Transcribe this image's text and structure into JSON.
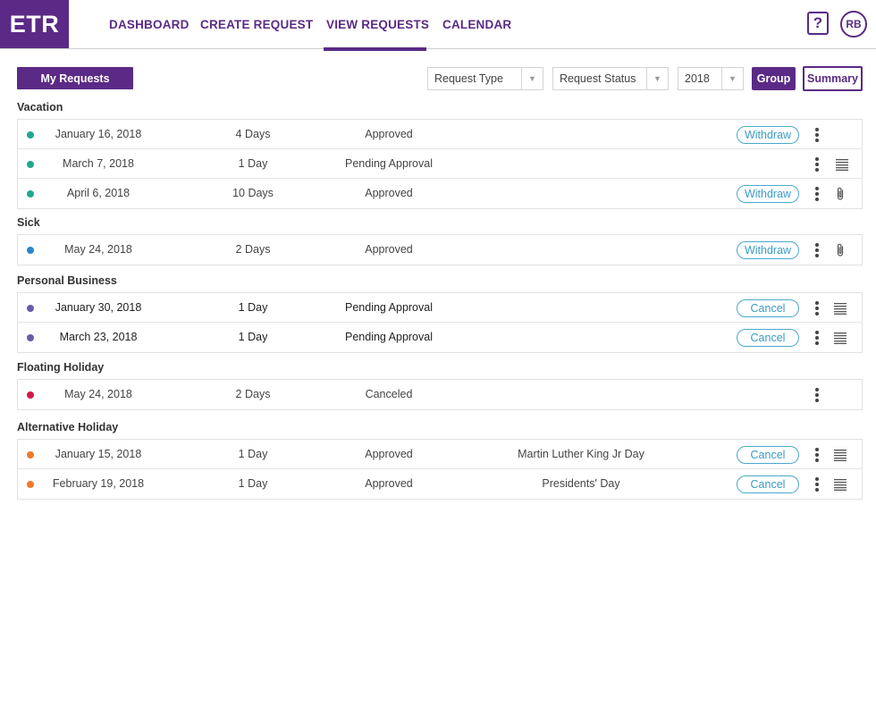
{
  "app": {
    "logo": "ETR"
  },
  "nav": {
    "items": [
      {
        "label": "DASHBOARD"
      },
      {
        "label": "CREATE REQUEST"
      },
      {
        "label": "VIEW REQUESTS"
      },
      {
        "label": "CALENDAR"
      }
    ],
    "active": "VIEW REQUESTS"
  },
  "header": {
    "help_label": "?",
    "user_initials": "RB"
  },
  "toolbar": {
    "my_requests_label": "My Requests",
    "filters": [
      {
        "value": "Request Type"
      },
      {
        "value": "Request Status"
      },
      {
        "value": "2018"
      }
    ],
    "group_label": "Group",
    "summary_label": "Summary"
  },
  "colors": {
    "brand": "#5b2a86",
    "vacation": "#20a88e",
    "sick": "#2b86c5",
    "personal_business": "#6a5aa8",
    "floating_holiday": "#d21a4a",
    "alternative_holiday": "#ee7a2a",
    "action_outline": "#4aa8cc"
  },
  "groups": [
    {
      "title": "Vacation",
      "rows": [
        {
          "date": "January 16, 2018",
          "duration": "4 Days",
          "status": "Approved",
          "note": "",
          "action": "Withdraw",
          "icon": ""
        },
        {
          "date": "March 7, 2018",
          "duration": "1 Day",
          "status": "Pending Approval",
          "note": "",
          "action": "",
          "icon": "notes-icon"
        },
        {
          "date": "April 6, 2018",
          "duration": "10 Days",
          "status": "Approved",
          "note": "",
          "action": "Withdraw",
          "icon": "paperclip-icon"
        }
      ]
    },
    {
      "title": "Sick",
      "rows": [
        {
          "date": "May 24, 2018",
          "duration": "2 Days",
          "status": "Approved",
          "note": "",
          "action": "Withdraw",
          "icon": "paperclip-icon"
        }
      ]
    },
    {
      "title": "Personal Business",
      "rows": [
        {
          "date": "January 30, 2018",
          "duration": "1 Day",
          "status": "Pending Approval",
          "note": "",
          "action": "Cancel",
          "icon": "notes-icon"
        },
        {
          "date": "March 23, 2018",
          "duration": "1 Day",
          "status": "Pending Approval",
          "note": "",
          "action": "Cancel",
          "icon": "notes-icon"
        }
      ]
    },
    {
      "title": "Floating Holiday",
      "rows": [
        {
          "date": "May 24, 2018",
          "duration": "2 Days",
          "status": "Canceled",
          "note": "",
          "action": "",
          "icon": ""
        }
      ]
    },
    {
      "title": "Alternative Holiday",
      "rows": [
        {
          "date": "January 15, 2018",
          "duration": "1 Day",
          "status": "Approved",
          "note": "Martin Luther King Jr Day",
          "action": "Cancel",
          "icon": "notes-icon"
        },
        {
          "date": "February 19, 2018",
          "duration": "1 Day",
          "status": "Approved",
          "note": "Presidents' Day",
          "action": "Cancel",
          "icon": "notes-icon"
        }
      ]
    }
  ]
}
